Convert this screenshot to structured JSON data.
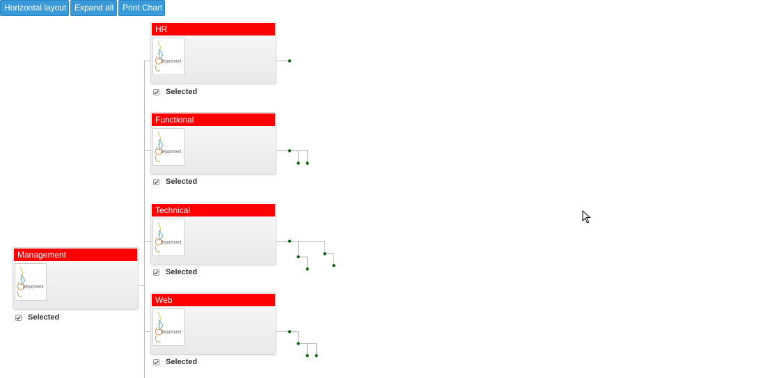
{
  "toolbar": {
    "buttons": [
      {
        "label": "Horizontal layout"
      },
      {
        "label": "Expand all"
      },
      {
        "label": "Print Chart"
      }
    ]
  },
  "chart": {
    "root": {
      "title": "Management",
      "selected_label": "Selected",
      "image_text": "Department"
    },
    "children": [
      {
        "title": "HR",
        "selected_label": "Selected",
        "image_text": "Department"
      },
      {
        "title": "Functional",
        "selected_label": "Selected",
        "image_text": "Department"
      },
      {
        "title": "Technical",
        "selected_label": "Selected",
        "image_text": "Department"
      },
      {
        "title": "Web",
        "selected_label": "Selected",
        "image_text": "Department"
      }
    ]
  },
  "colors": {
    "header_red": "#ff0000",
    "button_blue": "#3a9ad9",
    "collapsed_dot_green": "#006400",
    "connector_gray": "#bbbbbb"
  }
}
